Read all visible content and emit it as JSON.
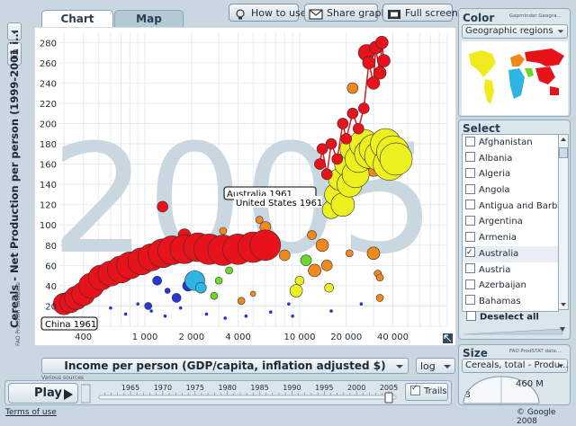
{
  "tabs": {
    "chart": "Chart",
    "map": "Map"
  },
  "toolbar": {
    "how_to_use": "How to use",
    "share_graph": "Share graph",
    "full_screen": "Full screen"
  },
  "y_axis": {
    "scale": "lin",
    "label": "Cereals - Net Production per person (1999-2001 i...",
    "source": "FAO ProdSTAT database",
    "ticks": [
      "0",
      "20",
      "40",
      "60",
      "80",
      "100",
      "120",
      "140",
      "160",
      "180",
      "200",
      "220",
      "240",
      "260",
      "280"
    ]
  },
  "x_axis": {
    "label": "Income per person (GDP/capita, inflation adjusted $)",
    "scale": "log",
    "source": "Various sources",
    "ticks": [
      "400",
      "1 000",
      "2 000",
      "4 000",
      "10 000",
      "20 000",
      "40 000"
    ]
  },
  "year_watermark": "2005",
  "bubble_labels": {
    "australia": "Australia 1961",
    "united_states": "United States 1961",
    "china": "China 1961"
  },
  "color_panel": {
    "title": "Color",
    "source": "Gapminder Geogra...",
    "selected": "Geographic regions"
  },
  "select_panel": {
    "title": "Select",
    "countries": [
      {
        "name": "Afghanistan",
        "checked": false
      },
      {
        "name": "Albania",
        "checked": false
      },
      {
        "name": "Algeria",
        "checked": false
      },
      {
        "name": "Angola",
        "checked": false
      },
      {
        "name": "Antigua and Barbuda",
        "checked": false
      },
      {
        "name": "Argentina",
        "checked": false
      },
      {
        "name": "Armenia",
        "checked": false
      },
      {
        "name": "Australia",
        "checked": true
      },
      {
        "name": "Austria",
        "checked": false
      },
      {
        "name": "Azerbaijan",
        "checked": false
      },
      {
        "name": "Bahamas",
        "checked": false
      },
      {
        "name": "Bangladesh",
        "checked": false
      },
      {
        "name": "Barbados",
        "checked": false
      }
    ],
    "deselect_all": "Deselect all"
  },
  "size_panel": {
    "title": "Size",
    "source": "FAO ProdSTAT data...",
    "selected": "Cereals, total - Produ...",
    "max_value": "460 M",
    "min_value": "3"
  },
  "player": {
    "play": "Play",
    "years": [
      "1965",
      "1970",
      "1975",
      "1980",
      "1985",
      "1990",
      "1995",
      "2000",
      "2005"
    ],
    "trails": "Trails",
    "trails_checked": true
  },
  "footer": {
    "terms": "Terms of use",
    "copyright": "© Google 2008"
  },
  "colors": {
    "background": "#c9d7e1",
    "red": "#e8121b",
    "yellow": "#ecf01f",
    "orange": "#f0891d",
    "cyan": "#2fb4e6",
    "green": "#6cd82c",
    "blue": "#2636d6",
    "watermark": "#c9d7e1"
  },
  "chart_data": {
    "type": "scatter",
    "x_scale": "log",
    "xlim": [
      280,
      90000
    ],
    "ylim": [
      0,
      290
    ],
    "year": "2005",
    "trails": [
      {
        "name": "China",
        "color": "red",
        "points": [
          [
            300,
            22
          ],
          [
            330,
            24
          ],
          [
            360,
            28
          ],
          [
            400,
            32
          ],
          [
            450,
            40
          ],
          [
            520,
            48
          ],
          [
            600,
            52
          ],
          [
            700,
            56
          ],
          [
            800,
            60
          ],
          [
            950,
            64
          ],
          [
            1100,
            68
          ],
          [
            1300,
            72
          ],
          [
            1500,
            75
          ],
          [
            1800,
            76
          ],
          [
            2200,
            78
          ],
          [
            2600,
            76
          ],
          [
            3200,
            75
          ],
          [
            4000,
            76
          ],
          [
            5000,
            78
          ],
          [
            6000,
            80
          ]
        ],
        "radius": [
          12,
          12,
          13,
          13,
          14,
          14,
          14,
          15,
          15,
          15,
          15,
          16,
          16,
          16,
          16,
          17,
          17,
          17,
          17,
          17
        ]
      },
      {
        "name": "United States",
        "color": "yellow",
        "points": [
          [
            16000,
            115
          ],
          [
            17000,
            130
          ],
          [
            18000,
            145
          ],
          [
            19000,
            120
          ],
          [
            20000,
            160
          ],
          [
            21000,
            140
          ],
          [
            22000,
            175
          ],
          [
            23000,
            150
          ],
          [
            24000,
            165
          ],
          [
            26000,
            180
          ],
          [
            28000,
            170
          ],
          [
            30000,
            175
          ],
          [
            33000,
            168
          ],
          [
            36000,
            180
          ],
          [
            38000,
            160
          ],
          [
            40000,
            172
          ],
          [
            42000,
            165
          ]
        ],
        "radius": [
          10,
          12,
          12,
          13,
          13,
          14,
          14,
          15,
          15,
          16,
          16,
          16,
          17,
          17,
          18,
          18,
          18
        ]
      },
      {
        "name": "Australia",
        "color": "red",
        "points": [
          [
            13500,
            160
          ],
          [
            14000,
            175
          ],
          [
            15000,
            150
          ],
          [
            16000,
            180
          ],
          [
            17500,
            165
          ],
          [
            19000,
            200
          ],
          [
            20000,
            185
          ],
          [
            22000,
            210
          ],
          [
            24000,
            195
          ],
          [
            26000,
            215
          ],
          [
            28000,
            260
          ],
          [
            30000,
            240
          ],
          [
            31000,
            275
          ],
          [
            33000,
            250
          ],
          [
            34000,
            280
          ],
          [
            35000,
            262
          ]
        ],
        "radius": [
          6,
          6,
          6,
          6,
          6,
          6,
          6,
          6,
          6,
          6,
          7,
          7,
          7,
          7,
          7,
          7
        ]
      }
    ],
    "bubbles": [
      {
        "x": 300,
        "y": 22,
        "r": 4,
        "color": "blue"
      },
      {
        "x": 520,
        "y": 55,
        "r": 4,
        "color": "blue"
      },
      {
        "x": 700,
        "y": 60,
        "r": 3,
        "color": "blue"
      },
      {
        "x": 850,
        "y": 52,
        "r": 4,
        "color": "blue"
      },
      {
        "x": 1000,
        "y": 58,
        "r": 6,
        "color": "cyan"
      },
      {
        "x": 1050,
        "y": 20,
        "r": 4,
        "color": "blue"
      },
      {
        "x": 1200,
        "y": 45,
        "r": 5,
        "color": "blue"
      },
      {
        "x": 1400,
        "y": 35,
        "r": 3,
        "color": "blue"
      },
      {
        "x": 1600,
        "y": 28,
        "r": 5,
        "color": "blue"
      },
      {
        "x": 1900,
        "y": 40,
        "r": 6,
        "color": "blue"
      },
      {
        "x": 2100,
        "y": 45,
        "r": 11,
        "color": "cyan"
      },
      {
        "x": 2300,
        "y": 38,
        "r": 6,
        "color": "cyan"
      },
      {
        "x": 2800,
        "y": 30,
        "r": 4,
        "color": "green"
      },
      {
        "x": 3000,
        "y": 45,
        "r": 4,
        "color": "green"
      },
      {
        "x": 3500,
        "y": 55,
        "r": 4,
        "color": "green"
      },
      {
        "x": 4200,
        "y": 25,
        "r": 4,
        "color": "orange"
      },
      {
        "x": 5000,
        "y": 32,
        "r": 3,
        "color": "orange"
      },
      {
        "x": 1300,
        "y": 118,
        "r": 6,
        "color": "red"
      },
      {
        "x": 1800,
        "y": 90,
        "r": 7,
        "color": "red"
      },
      {
        "x": 3200,
        "y": 94,
        "r": 4,
        "color": "orange"
      },
      {
        "x": 5500,
        "y": 105,
        "r": 4,
        "color": "orange"
      },
      {
        "x": 8000,
        "y": 70,
        "r": 6,
        "color": "orange"
      },
      {
        "x": 9500,
        "y": 35,
        "r": 7,
        "color": "yellow"
      },
      {
        "x": 10000,
        "y": 45,
        "r": 5,
        "color": "yellow"
      },
      {
        "x": 12500,
        "y": 55,
        "r": 7,
        "color": "orange"
      },
      {
        "x": 11000,
        "y": 65,
        "r": 6,
        "color": "green"
      },
      {
        "x": 12000,
        "y": 90,
        "r": 5,
        "color": "orange"
      },
      {
        "x": 15000,
        "y": 60,
        "r": 6,
        "color": "orange"
      },
      {
        "x": 14000,
        "y": 80,
        "r": 7,
        "color": "orange"
      },
      {
        "x": 15500,
        "y": 38,
        "r": 5,
        "color": "yellow"
      },
      {
        "x": 21000,
        "y": 72,
        "r": 4,
        "color": "orange"
      },
      {
        "x": 30000,
        "y": 72,
        "r": 7,
        "color": "orange"
      },
      {
        "x": 32000,
        "y": 52,
        "r": 4,
        "color": "orange"
      },
      {
        "x": 33000,
        "y": 28,
        "r": 4,
        "color": "orange"
      },
      {
        "x": 33000,
        "y": 48,
        "r": 4,
        "color": "orange"
      },
      {
        "x": 30000,
        "y": 155,
        "r": 8,
        "color": "orange"
      },
      {
        "x": 38000,
        "y": 190,
        "r": 5,
        "color": "orange"
      },
      {
        "x": 6000,
        "y": 98,
        "r": 6,
        "color": "orange"
      },
      {
        "x": 22000,
        "y": 235,
        "r": 6,
        "color": "orange"
      },
      {
        "x": 27000,
        "y": 270,
        "r": 9,
        "color": "red"
      },
      {
        "x": 32000,
        "y": 275,
        "r": 6,
        "color": "red"
      }
    ]
  }
}
